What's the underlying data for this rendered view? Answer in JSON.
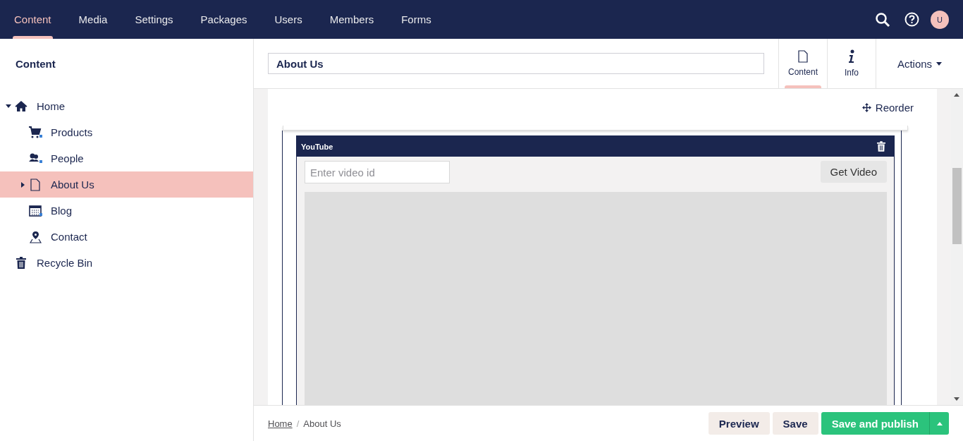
{
  "top_nav": {
    "sections": [
      {
        "label": "Content",
        "selected": true
      },
      {
        "label": "Media",
        "selected": false
      },
      {
        "label": "Settings",
        "selected": false
      },
      {
        "label": "Packages",
        "selected": false
      },
      {
        "label": "Users",
        "selected": false
      },
      {
        "label": "Members",
        "selected": false
      },
      {
        "label": "Forms",
        "selected": false
      }
    ],
    "avatar": "U"
  },
  "sidebar": {
    "title": "Content",
    "tree": [
      {
        "label": "Home",
        "kind": "home",
        "expanded": true,
        "selected": false,
        "children": [
          {
            "label": "Products",
            "kind": "cart",
            "selected": false
          },
          {
            "label": "People",
            "kind": "people",
            "selected": false
          },
          {
            "label": "About Us",
            "kind": "document",
            "expanded": false,
            "selected": true
          },
          {
            "label": "Blog",
            "kind": "calendar",
            "selected": false
          },
          {
            "label": "Contact",
            "kind": "pin",
            "selected": false
          }
        ]
      },
      {
        "label": "Recycle Bin",
        "kind": "trash",
        "selected": false
      }
    ]
  },
  "editor": {
    "name": "About Us",
    "apps": [
      {
        "label": "Content",
        "kind": "document",
        "selected": true
      },
      {
        "label": "Info",
        "kind": "info",
        "selected": false
      }
    ],
    "actions": "Actions",
    "reorder": "Reorder",
    "block": {
      "title": "YouTube",
      "placeholder": "Enter video id",
      "button": "Get Video"
    }
  },
  "footer": {
    "separator": "/",
    "breadcrumb": [
      {
        "label": "Home",
        "link": true
      },
      {
        "label": "About Us",
        "link": false
      }
    ],
    "buttons": [
      {
        "label": "Preview",
        "kind": "plain"
      },
      {
        "label": "Save",
        "kind": "plain"
      },
      {
        "label": "Save and publish",
        "kind": "primary"
      }
    ]
  }
}
